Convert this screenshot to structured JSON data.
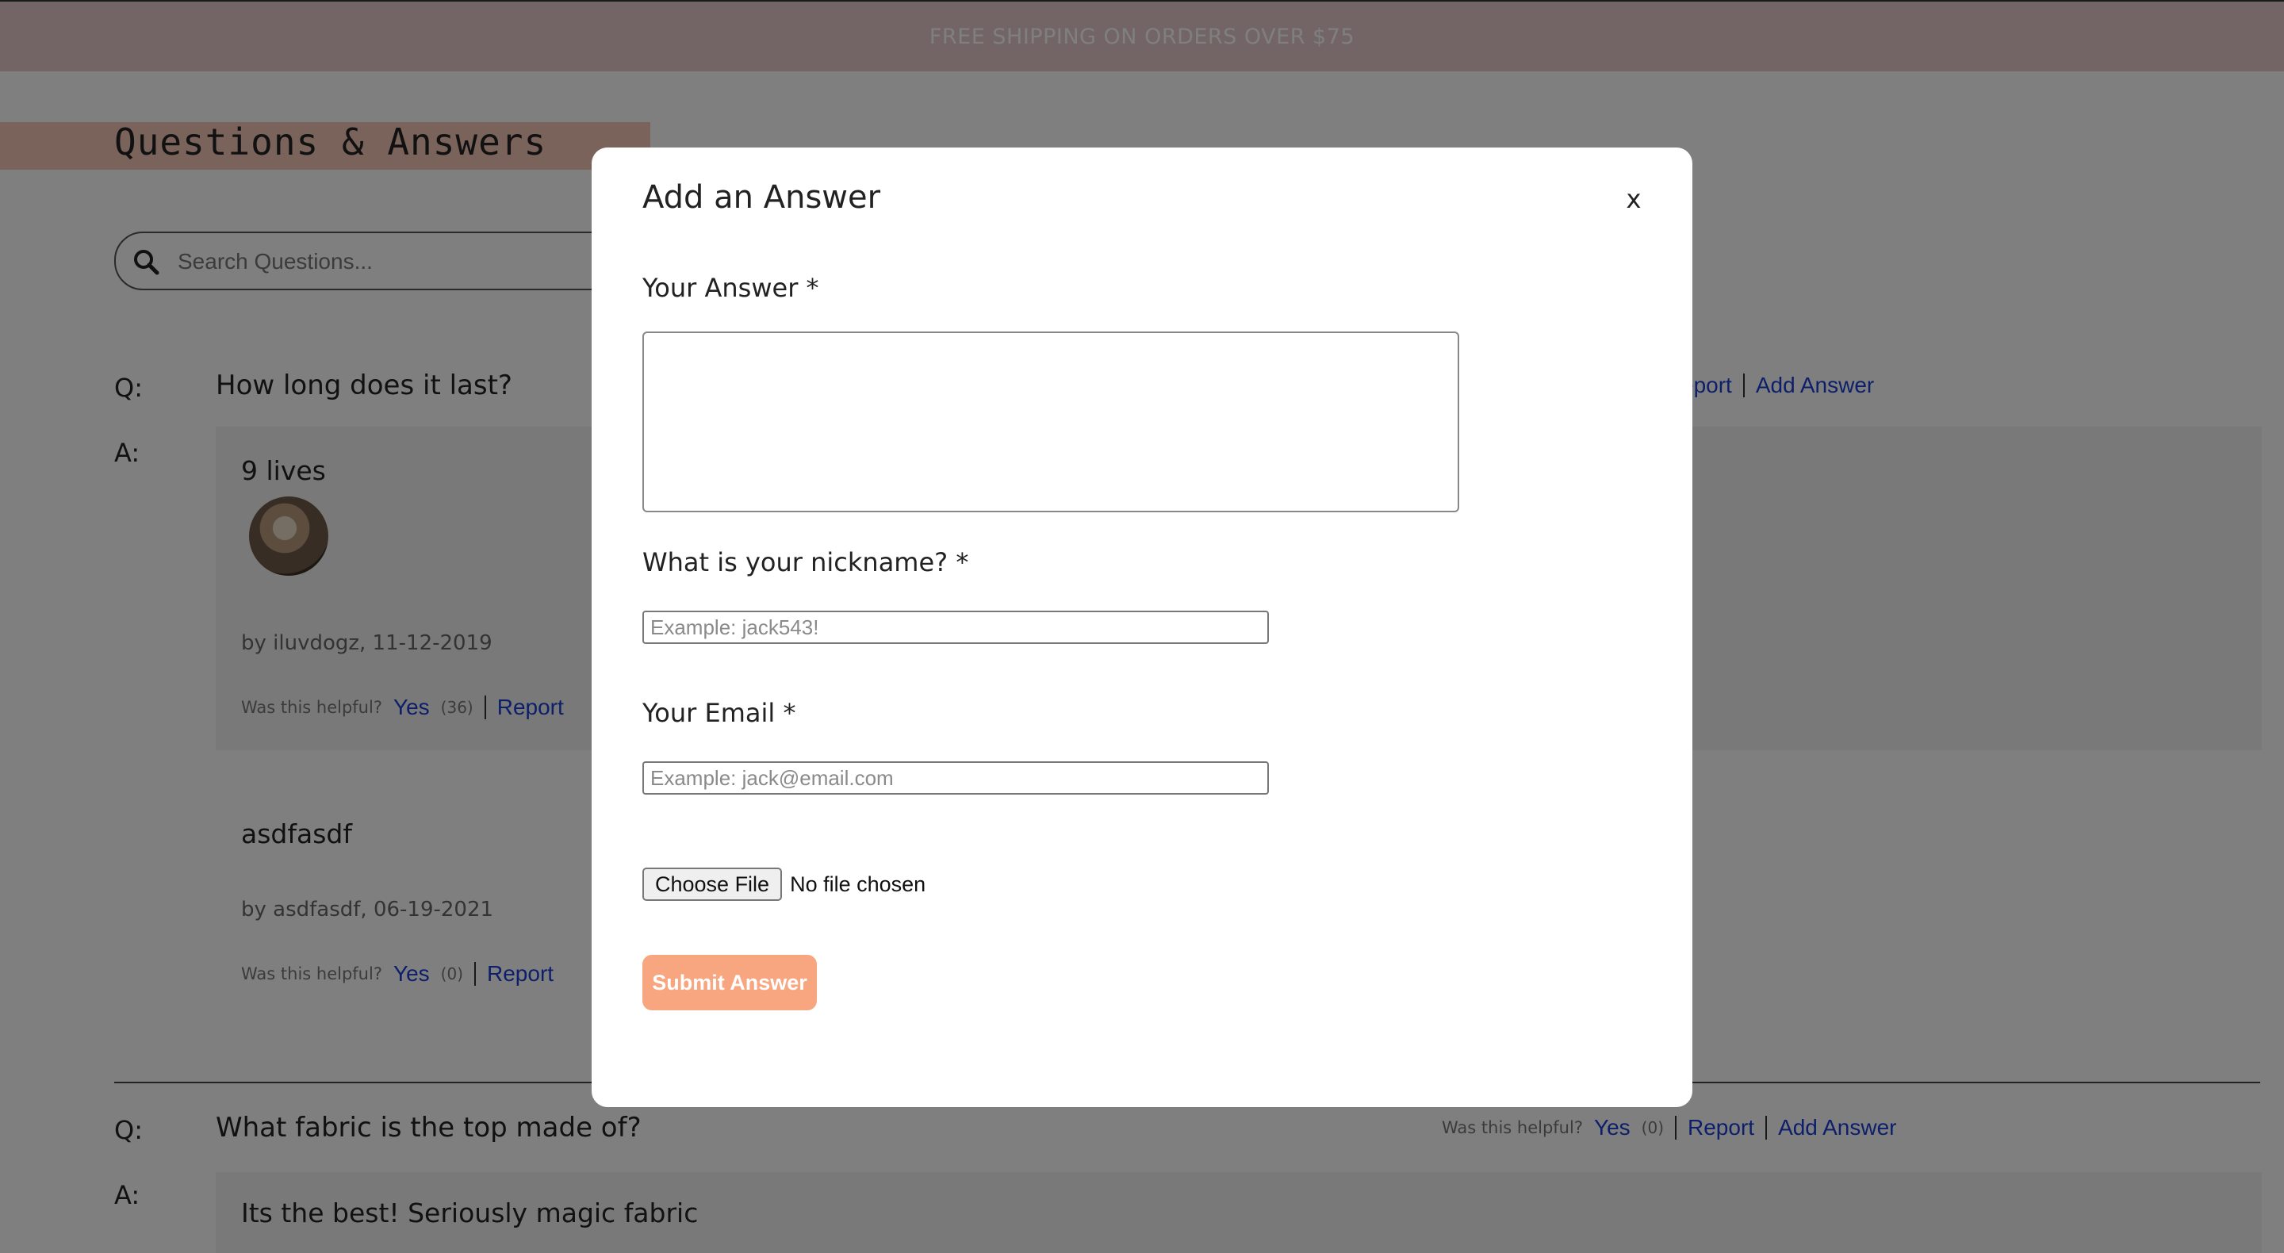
{
  "banner": {
    "text": "FREE SHIPPING ON ORDERS OVER $75"
  },
  "qa": {
    "title": "Questions & Answers",
    "search_placeholder": "Search Questions...",
    "q_prefix": "Q:",
    "a_prefix": "A:",
    "helpful_text": "Was this helpful?",
    "yes_label": "Yes",
    "report_label": "Report",
    "add_answer_label": "Add Answer",
    "questions": [
      {
        "text": "How long does it last?",
        "report_partial": "eport",
        "answers": [
          {
            "body": "9 lives",
            "meta": "by iluvdogz, 11-12-2019",
            "count": "(36)"
          },
          {
            "body": "asdfasdf",
            "meta": "by asdfasdf, 06-19-2021",
            "count": "(0)"
          }
        ]
      },
      {
        "text": "What fabric is the top made of?",
        "count": "(0)",
        "answers": [
          {
            "body": "Its the best! Seriously magic fabric"
          }
        ]
      }
    ]
  },
  "modal": {
    "title": "Add an Answer",
    "close_label": "x",
    "answer_label": "Your Answer *",
    "answer_value": "",
    "nickname_label": "What is your nickname? *",
    "nickname_placeholder": "Example: jack543!",
    "email_label": "Your Email *",
    "email_placeholder": "Example: jack@email.com",
    "file_button_label": "Choose File",
    "file_status": "No file chosen",
    "submit_label": "Submit Answer"
  },
  "colors": {
    "banner_bg": "#e7cbcb",
    "title_bar": "#f4c7b6",
    "link": "#1a3fd6",
    "submit_bg": "#f7a680",
    "overlay": "rgba(0,0,0,0.5)"
  }
}
